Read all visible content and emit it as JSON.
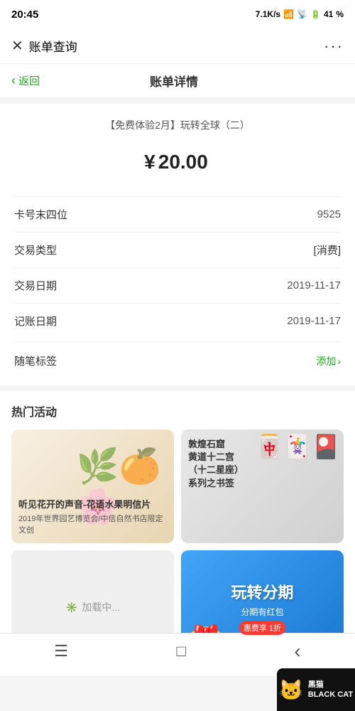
{
  "statusBar": {
    "time": "20:45",
    "signal": "●●●",
    "network": "7.1K/s",
    "networkType": "HD",
    "wifi": "WiFi",
    "battery": "41"
  },
  "topBar": {
    "title": "账单查询",
    "closeIcon": "✕",
    "moreIcon": "···"
  },
  "navBar": {
    "backLabel": "返回",
    "pageTitle": "账单详情"
  },
  "bill": {
    "title": "【免费体验2月】玩转全球（二）",
    "currencySymbol": "¥",
    "amount": "20.00",
    "fields": [
      {
        "label": "卡号末四位",
        "value": "9525"
      },
      {
        "label": "交易类型",
        "value": "[消费]"
      },
      {
        "label": "交易日期",
        "value": "2019-11-17"
      },
      {
        "label": "记账日期",
        "value": "2019-11-17"
      }
    ],
    "tagLabel": "随笔标签",
    "addLabel": "添加"
  },
  "hotActivities": {
    "sectionTitle": "热门活动",
    "cards": [
      {
        "type": "nature",
        "title": "听见花开的声音-花语水果明信片",
        "subtitle": "2019年世界园艺博览会/中信自然书店限定文创",
        "emoji": "🌿"
      },
      {
        "type": "dunhuang",
        "line1": "敦煌石窟",
        "line2": "黄道十二宫",
        "line3": "（十二星座）",
        "line4": "系列之书签",
        "emoji": "🎴"
      },
      {
        "type": "loading",
        "label": "加载中..."
      },
      {
        "type": "promo",
        "title": "玩转分期",
        "subtitle": "分期有红包",
        "badge": "惠费享 1折",
        "emoji": "🎁"
      }
    ]
  },
  "bottomNav": {
    "menuIcon": "☰",
    "homeIcon": "□",
    "backIcon": "‹"
  },
  "watermark": {
    "icon": "🐱",
    "line1": "黑猫",
    "line2": "BLACK CAT"
  }
}
